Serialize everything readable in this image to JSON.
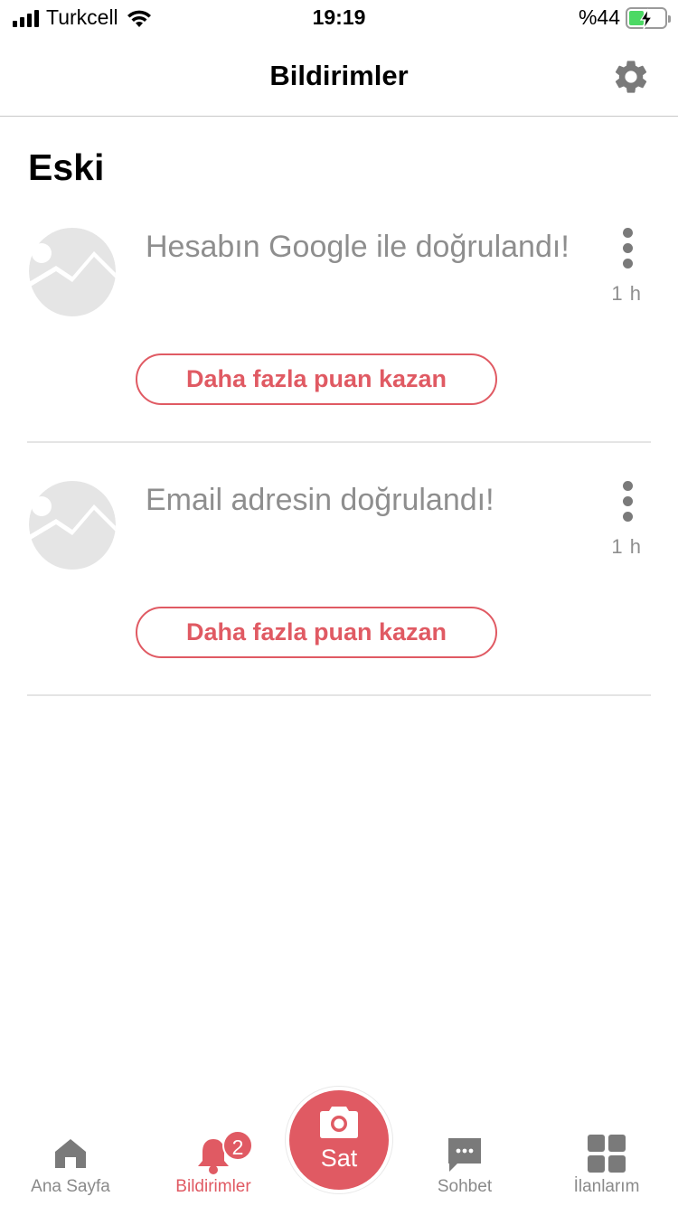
{
  "status_bar": {
    "carrier": "Turkcell",
    "time": "19:19",
    "battery_text": "%44",
    "battery_level": 0.44
  },
  "header": {
    "title": "Bildirimler",
    "settings_icon": "gear-icon"
  },
  "section": {
    "title": "Eski"
  },
  "notifications": [
    {
      "text": "Hesabın Google ile doğrulandı!",
      "time": "1 h",
      "cta": "Daha fazla puan kazan"
    },
    {
      "text": "Email adresin doğrulandı!",
      "time": "1 h",
      "cta": "Daha fazla puan kazan"
    }
  ],
  "tabbar": {
    "home": "Ana Sayfa",
    "notifications": "Bildirimler",
    "notifications_badge": "2",
    "sell": "Sat",
    "chat": "Sohbet",
    "listings": "İlanlarım"
  },
  "colors": {
    "accent": "#e05a63",
    "muted_text": "#8e8e8e",
    "tab_icon": "#7a7a7a"
  }
}
